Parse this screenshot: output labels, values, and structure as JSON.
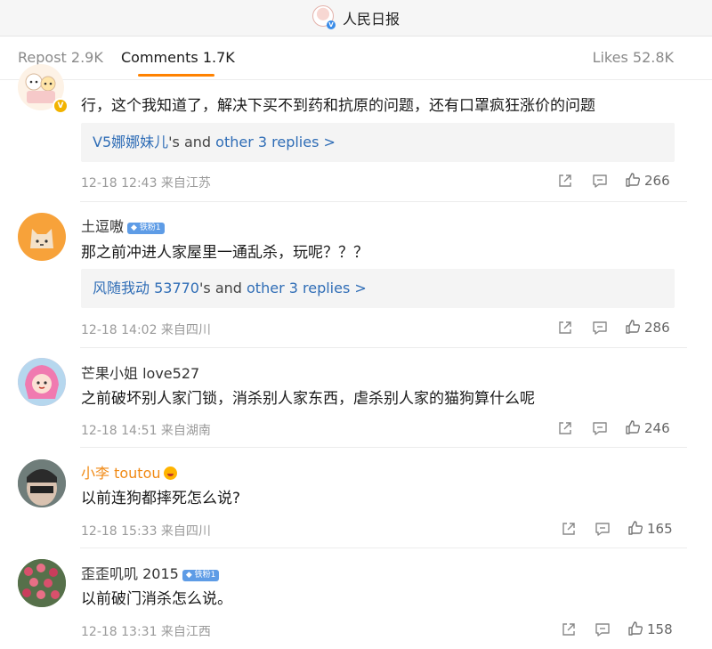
{
  "header": {
    "title": "人民日报"
  },
  "tabs": {
    "repost": "Repost 2.9K",
    "comments": "Comments 1.7K",
    "likes": "Likes 52.8K"
  },
  "accent_color": "#ff8200",
  "link_color": "#2f6db6",
  "comments": [
    {
      "username": "",
      "text": "行，这个我知道了，解决下买不到药和抗原的问题，还有口罩疯狂涨价的问题",
      "replies": {
        "name": "V5娜娜妹儿",
        "mid": "'s and ",
        "more": "other 3 replies >"
      },
      "time": "12-18 12:43 来自江苏",
      "likes": "266"
    },
    {
      "username": "土逗嗷",
      "badge": "铁粉1",
      "text": "那之前冲进人家屋里一通乱杀，玩呢？？？",
      "replies": {
        "name": "风随我动 53770",
        "mid": "'s and ",
        "more": "other 3 replies >"
      },
      "time": "12-18 14:02 来自四川",
      "likes": "286"
    },
    {
      "username": "芒果小姐 love527",
      "text": "之前破坏别人家门锁，消杀别人家东西，虐杀别人家的猫狗算什么呢",
      "time": "12-18 14:51 来自湖南",
      "likes": "246"
    },
    {
      "username": "小李 toutou",
      "text": "以前连狗都摔死怎么说?",
      "time": "12-18 15:33 来自四川",
      "likes": "165"
    },
    {
      "username": "歪歪叽叽 2015",
      "badge": "铁粉1",
      "text": "以前破门消杀怎么说。",
      "time": "12-18 13:31 来自江西",
      "likes": "158"
    }
  ]
}
